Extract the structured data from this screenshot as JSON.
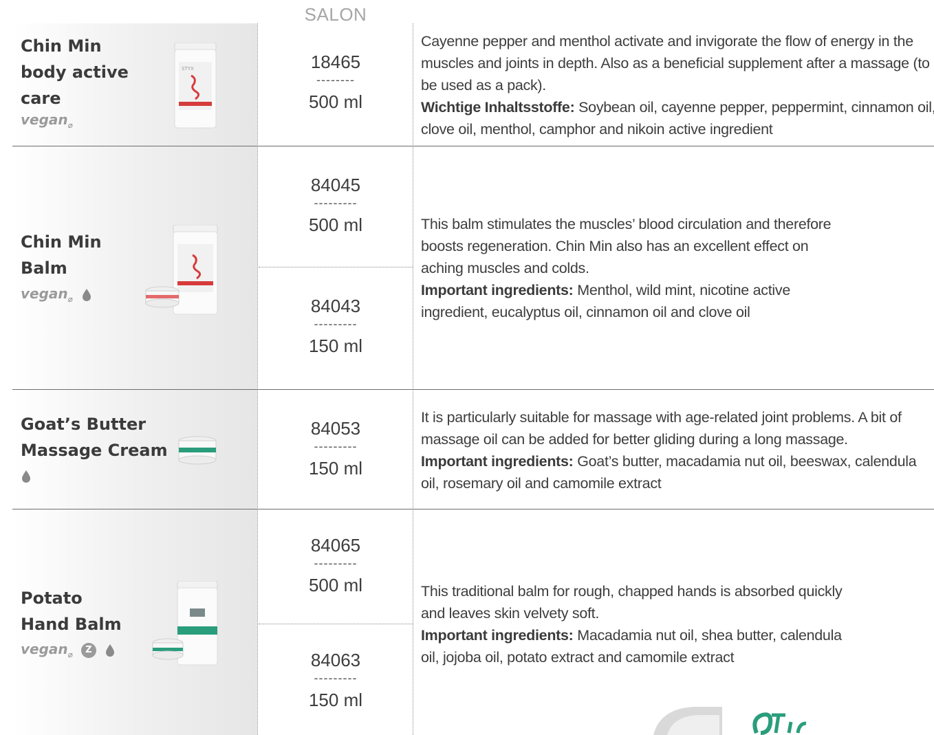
{
  "header": {
    "column_label": "SALON"
  },
  "products": [
    {
      "name_lines": [
        "Chin Min",
        "body active",
        "care"
      ],
      "vegan_label": "vegan",
      "badges": [
        "vegan"
      ],
      "variants": [
        {
          "code": "18465",
          "dashes": "--------",
          "size": "500 ml"
        }
      ],
      "description": "Cayenne pepper and menthol activate and invigorate the flow of energy in the muscles and joints in depth. Also as a beneficial supplement after a massage (to be used as a pack).",
      "ingredients_label": "Wichtige Inhaltsstoffe:",
      "ingredients": " Soybean oil, cayenne pepper, peppermint, cinnamon oil, clove oil, menthol, camphor and nikoin active ingredient"
    },
    {
      "name_lines": [
        "Chin Min",
        "Balm"
      ],
      "vegan_label": "vegan",
      "badges": [
        "vegan",
        "drop-icon"
      ],
      "variants": [
        {
          "code": "84045",
          "dashes": "---------",
          "size": "500 ml"
        },
        {
          "code": "84043",
          "dashes": "---------",
          "size": "150 ml"
        }
      ],
      "description": "This balm stimulates the muscles’ blood circulation and therefore boosts regeneration. Chin Min also has an excellent effect on aching muscles and colds.",
      "ingredients_label": "Important ingredients:",
      "ingredients": " Menthol, wild mint, nicotine active ingredient, eucalyptus oil, cinnamon oil and clove oil"
    },
    {
      "name_lines": [
        "Goat’s Butter",
        "Massage Cream"
      ],
      "vegan_label": "",
      "badges": [
        "drop-icon"
      ],
      "variants": [
        {
          "code": "84053",
          "dashes": "---------",
          "size": "150 ml"
        }
      ],
      "description": "It is particularly suitable for massage with age-related joint problems. A bit of massage oil can be added for better gliding during a long massage.",
      "ingredients_label": "Important ingredients:",
      "ingredients": " Goat’s butter, macadamia nut oil, beeswax, calendula oil, rosemary oil and camomile extract"
    },
    {
      "name_lines": [
        "Potato",
        "Hand Balm"
      ],
      "vegan_label": "vegan",
      "z_badge": "Z",
      "badges": [
        "vegan",
        "z-badge",
        "drop-icon"
      ],
      "variants": [
        {
          "code": "84065",
          "dashes": "---------",
          "size": "500 ml"
        },
        {
          "code": "84063",
          "dashes": "---------",
          "size": "150 ml"
        }
      ],
      "description": "This traditional balm for rough, chapped hands is absorbed quickly and leaves skin velvety soft.",
      "ingredients_label": "Important ingredients:",
      "ingredients": " Macadamia nut oil, shea butter, calendula oil, jojoba oil, potato extract and camomile extract"
    }
  ],
  "colors": {
    "text": "#3d3d3d",
    "muted": "#9a9a9a",
    "accent_green": "#2a9d7c",
    "accent_red": "#d63b3b"
  },
  "decor": {
    "corner_graphic": "tip-logo-fragment"
  }
}
